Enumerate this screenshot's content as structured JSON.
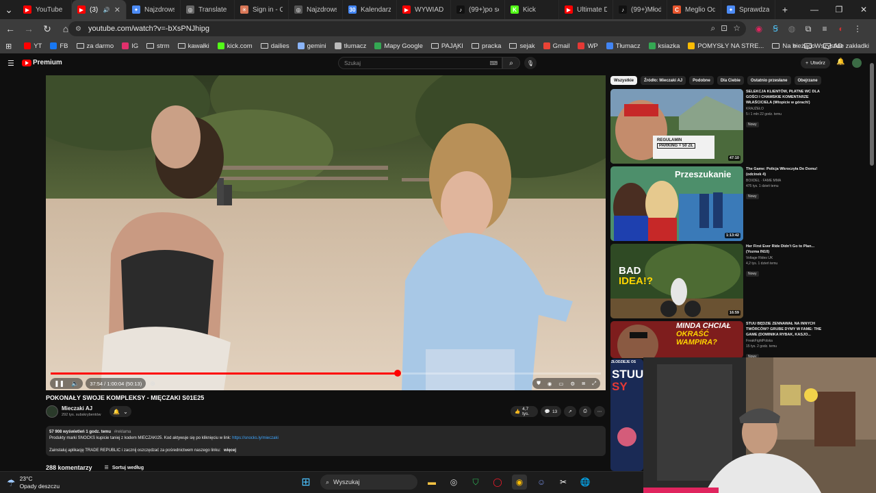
{
  "tabs": [
    {
      "title": "YouTube",
      "color": "#ff0000",
      "glyph": "▶"
    },
    {
      "title": "(3) Pi",
      "color": "#ff0000",
      "glyph": "▶",
      "active": true
    },
    {
      "title": "Najzdrowsze",
      "color": "#4c8bf5",
      "glyph": "✦"
    },
    {
      "title": "Translate Poli",
      "color": "#666666",
      "glyph": "◎"
    },
    {
      "title": "Sign in - Clau",
      "color": "#d97757",
      "glyph": "✳"
    },
    {
      "title": "Najzdrowsze",
      "color": "#555555",
      "glyph": "◎"
    },
    {
      "title": "Kalendarz Go",
      "color": "#4285f4",
      "glyph": "30"
    },
    {
      "title": "WYWIAD Z M",
      "color": "#ff0000",
      "glyph": "▶"
    },
    {
      "title": "(99+)po serw",
      "color": "#111111",
      "glyph": "♪"
    },
    {
      "title": "Kick",
      "color": "#53fc18",
      "glyph": "K"
    },
    {
      "title": "Ultimate Dop",
      "color": "#ff0000",
      "glyph": "▶"
    },
    {
      "title": "(99+)Młodzi",
      "color": "#111111",
      "glyph": "♪"
    },
    {
      "title": "Meglio Odth",
      "color": "#e8552d",
      "glyph": "C"
    },
    {
      "title": "Sprawdzanie",
      "color": "#4c8bf5",
      "glyph": "✦"
    }
  ],
  "browser": {
    "url": "youtube.com/watch?v=-bXsPNJhipg",
    "new_tab": "+",
    "win_min": "—",
    "win_max": "❐",
    "win_close": "✕"
  },
  "bookmarks": [
    {
      "label": "YT",
      "type": "icon",
      "color": "#ff0000"
    },
    {
      "label": "FB",
      "type": "icon",
      "color": "#1877f2"
    },
    {
      "label": "za darmo",
      "type": "folder"
    },
    {
      "label": "IG",
      "type": "icon",
      "color": "#e1306c"
    },
    {
      "label": "strm",
      "type": "folder"
    },
    {
      "label": "kawałki",
      "type": "folder"
    },
    {
      "label": "kick.com",
      "type": "icon",
      "color": "#53fc18"
    },
    {
      "label": "dailies",
      "type": "folder"
    },
    {
      "label": "gemini",
      "type": "icon",
      "color": "#8ab4f8"
    },
    {
      "label": "tłumacz",
      "type": "icon",
      "color": "#bbbbbb"
    },
    {
      "label": "Mapy Google",
      "type": "icon",
      "color": "#34a853"
    },
    {
      "label": "PAJĄKI",
      "type": "folder"
    },
    {
      "label": "pracka",
      "type": "folder"
    },
    {
      "label": "sejak",
      "type": "folder"
    },
    {
      "label": "Gmail",
      "type": "icon",
      "color": "#ea4335"
    },
    {
      "label": "WP",
      "type": "icon",
      "color": "#e53935"
    },
    {
      "label": "Tłumacz",
      "type": "icon",
      "color": "#4285f4"
    },
    {
      "label": "ksiazka",
      "type": "icon",
      "color": "#34a853"
    },
    {
      "label": "POMYSŁY NA STRE...",
      "type": "icon",
      "color": "#fbbc04"
    },
    {
      "label": "Na bieżąco",
      "type": "folder"
    },
    {
      "label": "AD",
      "type": "folder"
    }
  ],
  "bookmarks_more": "»",
  "bookmarks_all": "Wszystkie zakładki",
  "yt": {
    "logo": "Premium",
    "search_placeholder": "Szukaj",
    "create": "Utwórz"
  },
  "player": {
    "time": "37:54 / 1:00:04 (50:13)",
    "progress_fraction": 0.631
  },
  "video": {
    "title": "POKONAŁY SWOJE KOMPLEKSY - MIĘCZAKI S01E25",
    "channel": "Mieczaki AJ",
    "subs": "292 tys. subskrybentów",
    "likes": "4,7 tys.",
    "comments_count_btn": "13",
    "desc_meta": "57 908 wyświetleń  1 godz. temu",
    "desc_tag": "#reklama",
    "desc_line1": "Produkty marki SNOCKS kupicie taniej z kodem MIECZAKI25. Kod aktywuje się po kliknięciu w link: ",
    "desc_link": "https://snocks.ly/mieczaki",
    "desc_line2": "Zainstaluj aplikację TRADE REPUBLIC i zacznij oszczędzać za pośrednictwem naszego linku:",
    "desc_more": "więcej",
    "comments_header": "288 komentarzy",
    "sort": "Sortuj według"
  },
  "chips": [
    "Wszystkie",
    "Źródło: Mieczaki AJ",
    "Podobne",
    "Dla Ciebie",
    "Ostatnio przesłane",
    "Obejrzane"
  ],
  "recs": [
    {
      "title": "SELEKCJA KLIENTÓW, PŁATNE WC DLA GOŚCI I CHAMSKIE KOMENTARZE WŁAŚCICIELA (Wtopicie w górach!)",
      "channel": "KRAJŻEŁO",
      "meta": "5 i 1 mln  22 godz. temu",
      "badge": "Nowy",
      "duration": "47:10"
    },
    {
      "title": "The Game: Policja Wkroczyła Do Domu! (odcinek 4)",
      "channel": "BOXDEL · FAME MMA",
      "meta": "475 tys.  1 dzień temu",
      "badge": "Nowy",
      "duration": "1:13:42"
    },
    {
      "title": "Her First Ever Ride Didn't Go to Plan... (Yozma IN10)",
      "channel": "Voltage Rides UK",
      "meta": "4,2 tys.  1 dzień temu",
      "badge": "Nowy",
      "duration": "16:59"
    },
    {
      "title": "STUU BĘDZIE ZENNAWAŁ NA INNYCH TWÓRCÓW? GRUBE DYMY W FAME: THE GAME (DOMINIKA RYBAK, KASJO...",
      "channel": "FreakFightPolska",
      "meta": "15 tys.  2 godz. temu",
      "badge": "Nowy",
      "duration": ""
    }
  ],
  "thumb_text": {
    "t1_sign1": "REGULAMIN",
    "t1_sign2": "PARKING = 50 ZŁ",
    "t2_word": "Przeszukanie",
    "t3_word1": "BAD",
    "t3_word2": "IDEA!?",
    "t4_word1": "MINDA CHCIAŁ",
    "t4_word2": "OKRAŚĆ WAMPIRA?",
    "t5_word1": "STUU",
    "t5_word2": "SY",
    "t5_small": "ZŁODZIEJE OS"
  },
  "taskbar": {
    "temp": "23°C",
    "weather": "Opady deszczu",
    "search": "Wyszukaj"
  }
}
